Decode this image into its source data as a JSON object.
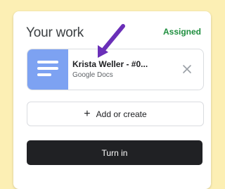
{
  "work_card": {
    "title": "Your work",
    "status": "Assigned",
    "attachment": {
      "name": "Krista Weller - #0...",
      "type": "Google Docs",
      "thumbnail_icon": "google-docs-icon",
      "remove_icon": "close-icon"
    },
    "add_button_label": "Add or create",
    "add_icon": "plus-icon",
    "turn_in_label": "Turn in"
  },
  "colors": {
    "status": "#1e8e3e",
    "docs_thumb": "#7da2f2",
    "primary_button": "#202124",
    "annotation_arrow": "#6a2fb8",
    "background": "#fcefb4"
  },
  "annotation_icon": "arrow-icon"
}
